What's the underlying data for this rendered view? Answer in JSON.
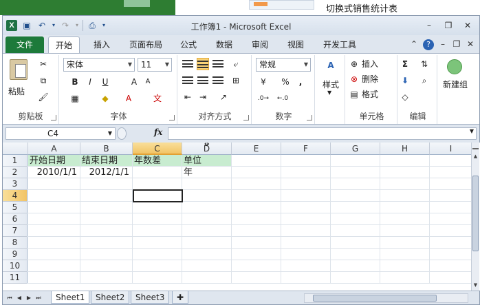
{
  "background": {
    "right_title": "切换式销售统计表"
  },
  "window": {
    "title": "工作簿1 - Microsoft Excel",
    "app_icon_letter": "X"
  },
  "tabs": {
    "file": "文件",
    "items": [
      "开始",
      "插入",
      "页面布局",
      "公式",
      "数据",
      "审阅",
      "视图",
      "开发工具"
    ],
    "active": "开始"
  },
  "ribbon": {
    "clipboard": {
      "label": "剪贴板",
      "paste": "粘贴"
    },
    "font": {
      "label": "字体",
      "name": "宋体",
      "size": "11",
      "bold": "B",
      "italic": "I",
      "underline": "U",
      "grow": "A",
      "shrink": "A",
      "color_a": "A",
      "wen": "文"
    },
    "alignment": {
      "label": "对齐方式"
    },
    "number": {
      "label": "数字",
      "format": "常规",
      "percent": "%",
      "comma": ","
    },
    "styles": {
      "label": "样式"
    },
    "cells": {
      "label": "单元格",
      "insert": "插入",
      "delete": "删除",
      "format": "格式"
    },
    "editing": {
      "label": "编辑",
      "sigma": "Σ"
    },
    "newgroup": {
      "label": "新建组"
    }
  },
  "formula_bar": {
    "name_box": "C4",
    "fx": "fx",
    "formula": ""
  },
  "sheet": {
    "columns": [
      "A",
      "B",
      "C",
      "D",
      "E",
      "F",
      "G",
      "H",
      "I"
    ],
    "rows": [
      "1",
      "2",
      "3",
      "4",
      "5",
      "6",
      "7",
      "8",
      "9",
      "10",
      "11"
    ],
    "cells": {
      "A1": "开始日期",
      "B1": "结束日期",
      "C1": "年数差",
      "D1": "单位",
      "A2": "2010/1/1",
      "B2": "2012/1/1",
      "D2": "年"
    },
    "tabs": [
      "Sheet1",
      "Sheet2",
      "Sheet3"
    ],
    "active_tab": "Sheet1"
  },
  "colors": {
    "header_fill": "#c8ecd0",
    "file_tab": "#1d7a3a",
    "accent": "#f9d276"
  }
}
